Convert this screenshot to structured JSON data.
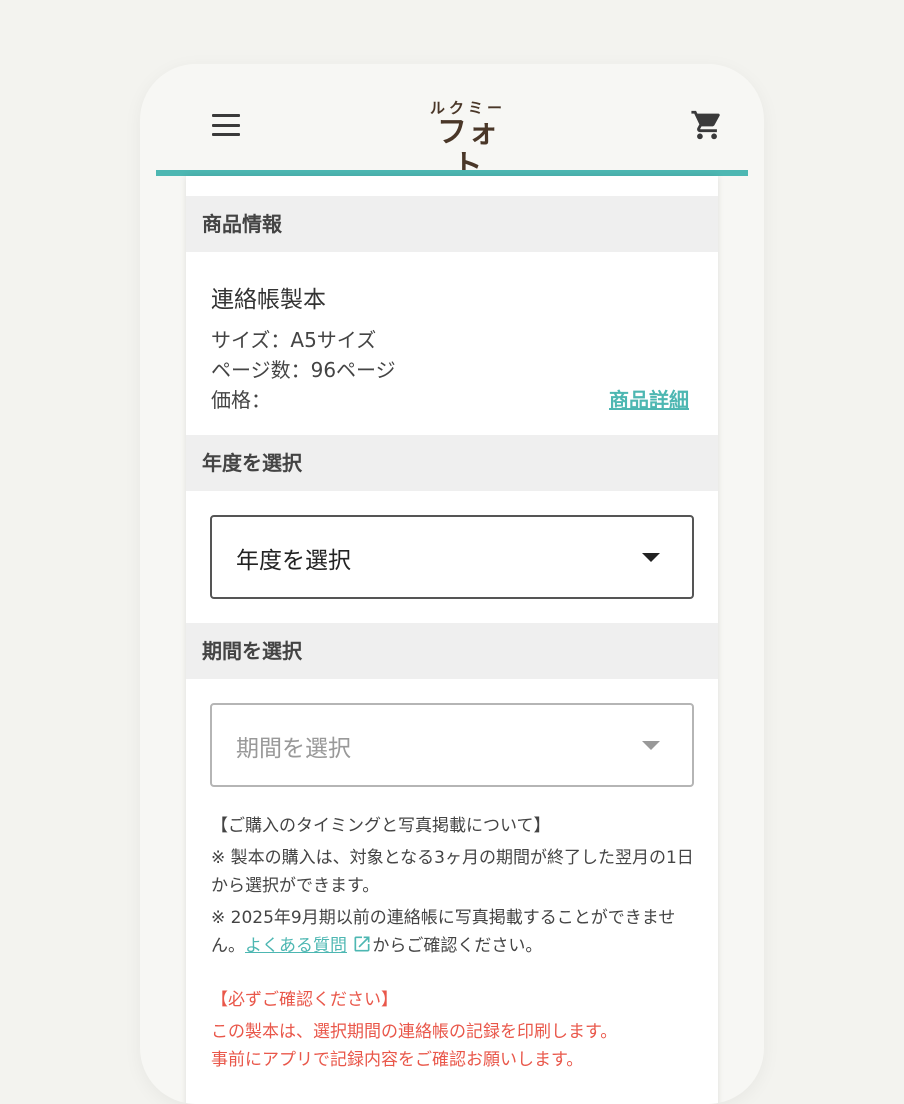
{
  "header": {
    "logo_small": "ルクミー",
    "logo_big": "フォト",
    "menu_icon": "hamburger-menu-icon",
    "cart_icon": "shopping-cart-icon",
    "accent_color": "#4db7b2"
  },
  "product_section": {
    "heading": "商品情報",
    "name": "連絡帳製本",
    "size": "サイズ：A5サイズ",
    "pages": "ページ数：96ページ",
    "price": "価格：",
    "detail_link": "商品詳細"
  },
  "year_section": {
    "heading": "年度を選択",
    "select_value": "年度を選択"
  },
  "period_section": {
    "heading": "期間を選択",
    "select_value": "期間を選択"
  },
  "notes": {
    "title": "【ご購入のタイミングと写真掲載について】",
    "line1": "※ 製本の購入は、対象となる3ヶ月の期間が終了した翌月の1日から選択ができます。",
    "line2_prefix": "※ 2025年9月期以前の連絡帳に写真掲載することができません。",
    "faq_link": "よくある質問",
    "external_icon": "external-link-icon",
    "line2_suffix": "からご確認ください。"
  },
  "warning": {
    "title": "【必ずご確認ください】",
    "line1": "この製本は、選択期間の連絡帳の記録を印刷します。",
    "line2": "事前にアプリで記録内容をご確認お願いします。",
    "color": "#e9574a"
  }
}
